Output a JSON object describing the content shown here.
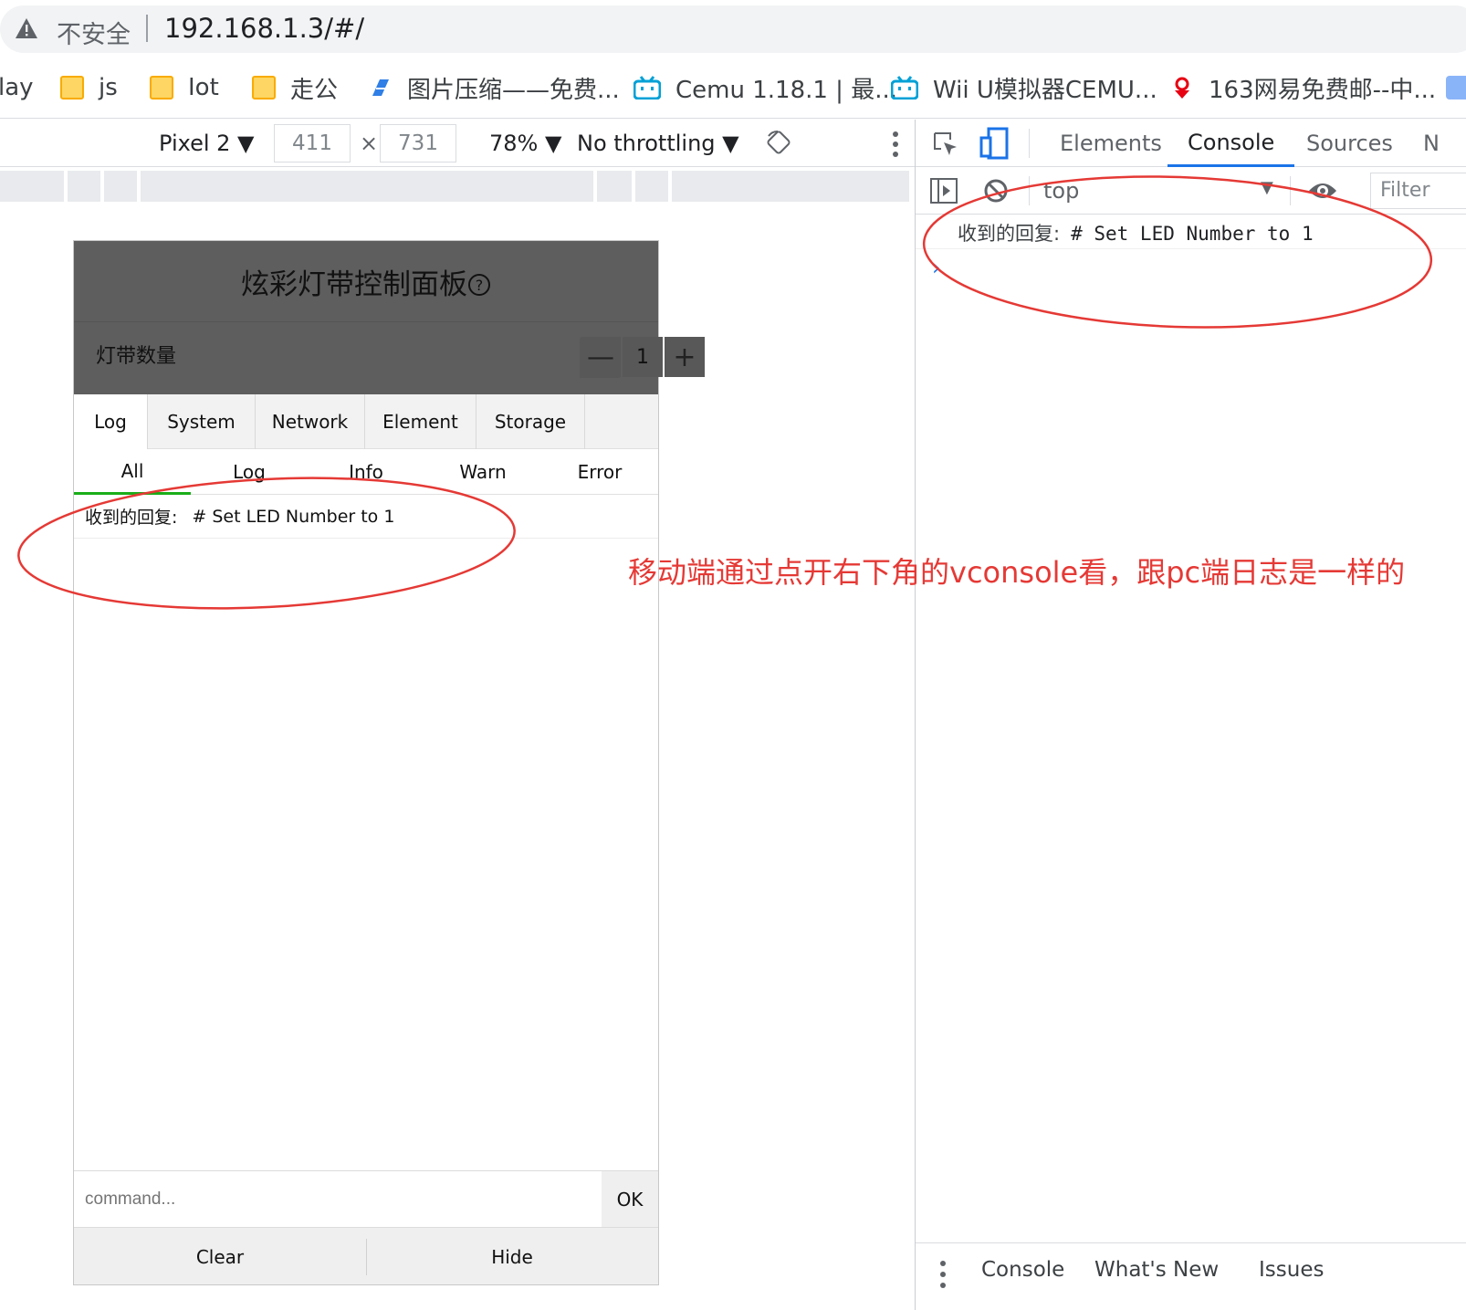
{
  "browser": {
    "insecure_label": "不安全",
    "url": "192.168.1.3/#/",
    "bookmarks": [
      {
        "label": "lay",
        "icon": "none"
      },
      {
        "label": "js",
        "icon": "folder-icon"
      },
      {
        "label": "Iot",
        "icon": "folder-icon"
      },
      {
        "label": "走公",
        "icon": "folder-icon"
      },
      {
        "label": "图片压缩——免费...",
        "icon": "tinypng-icon"
      },
      {
        "label": "Cemu 1.18.1 | 最...",
        "icon": "bilibili-icon"
      },
      {
        "label": "Wii U模拟器CEMU...",
        "icon": "bilibili-icon"
      },
      {
        "label": "163网易免费邮--中...",
        "icon": "netease-icon"
      }
    ]
  },
  "device_toolbar": {
    "device": "Pixel 2",
    "width": "411",
    "times": "×",
    "height": "731",
    "zoom": "78%",
    "throttling": "No throttling"
  },
  "app": {
    "title": "炫彩灯带控制面板",
    "help_glyph": "?",
    "count_label": "灯带数量",
    "count_minus": "—",
    "count_value": "1",
    "count_plus": "+"
  },
  "vconsole": {
    "tabs": [
      "Log",
      "System",
      "Network",
      "Element",
      "Storage"
    ],
    "active_tab": "Log",
    "subtabs": [
      "All",
      "Log",
      "Info",
      "Warn",
      "Error"
    ],
    "active_subtab": "All",
    "log_prefix": "收到的回复:",
    "log_message": "# Set LED Number to 1",
    "command_placeholder": "command...",
    "ok_label": "OK",
    "clear_label": "Clear",
    "hide_label": "Hide",
    "accent_color": "#1aad19"
  },
  "devtools": {
    "tabs": [
      "Elements",
      "Console",
      "Sources",
      "N"
    ],
    "active_tab": "Console",
    "context": "top",
    "filter_placeholder": "Filter",
    "log_prefix": "收到的回复:",
    "log_message": "# Set LED Number to 1",
    "prompt": "›",
    "drawer_tabs": [
      "Console",
      "What's New",
      "Issues"
    ]
  },
  "annotation": {
    "text": "移动端通过点开右下角的vconsole看，跟pc端日志是一样的",
    "color": "#e53935"
  }
}
